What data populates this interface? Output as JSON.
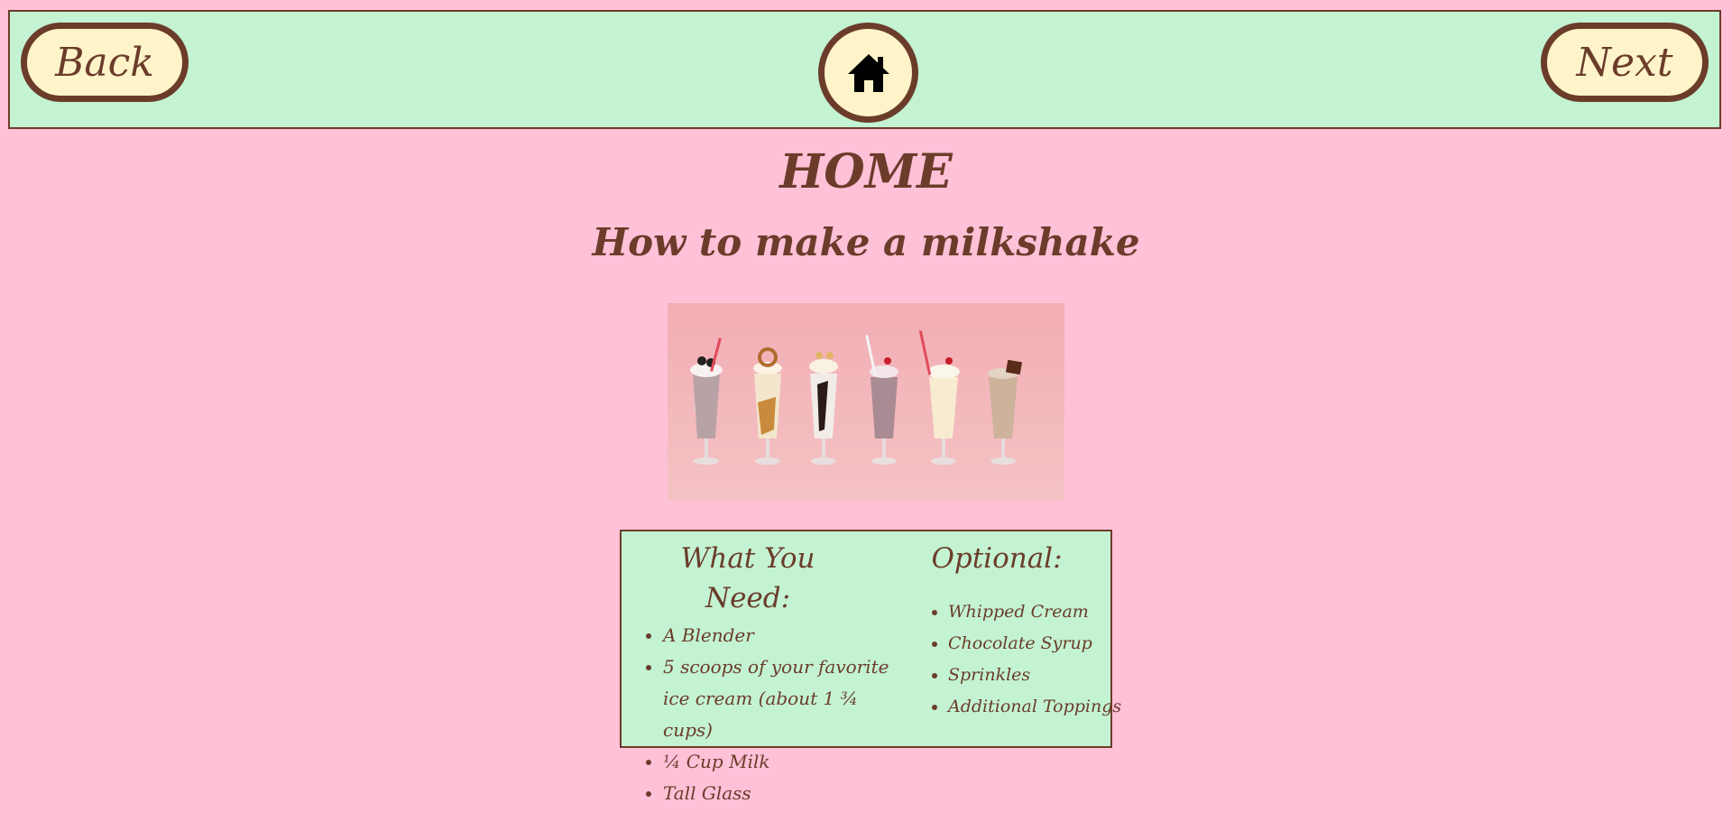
{
  "nav": {
    "back_label": "Back",
    "next_label": "Next",
    "home_icon": "home-icon"
  },
  "page": {
    "title": "HOME",
    "subtitle": "How to make a milkshake"
  },
  "hero_image": {
    "content": "six milkshakes in tall glasses on pink background"
  },
  "card": {
    "need": {
      "heading": "What You Need:",
      "items": [
        "A Blender",
        "5 scoops of your favorite ice cream (about 1 ¾ cups)",
        "¼ Cup Milk",
        "Tall Glass"
      ]
    },
    "optional": {
      "heading": "Optional:",
      "items": [
        "Whipped Cream",
        "Chocolate Syrup",
        "Sprinkles",
        "Additional Toppings"
      ]
    }
  },
  "colors": {
    "background": "#ffc1d8",
    "panel": "#c3f3d2",
    "button_fill": "#fff4c9",
    "accent": "#6b3c2a"
  }
}
